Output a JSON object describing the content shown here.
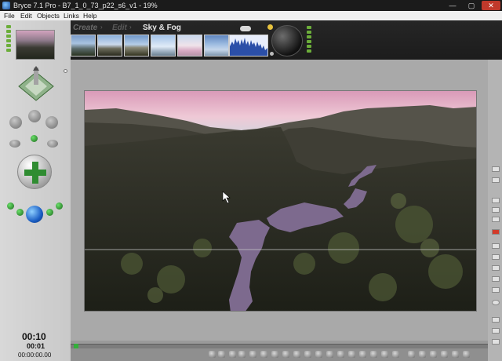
{
  "window": {
    "title": "Bryce 7.1  Pro - B7_1_0_73_p22_s6_v1 - 19%",
    "minimize": "—",
    "maximize": "▢",
    "close": "✕"
  },
  "menu": {
    "file": "File",
    "edit": "Edit",
    "objects": "Objects",
    "links": "Links",
    "help": "Help"
  },
  "palette": {
    "create": "Create",
    "edit": "Edit",
    "sky_fog": "Sky & Fog"
  },
  "time": {
    "main": "00:10",
    "frame": "00:01",
    "code": "00:00:00.00"
  },
  "colors": {
    "accent_green": "#6cae3a",
    "close_red": "#c0392b",
    "sky_pink": "#e8a8c2",
    "water": "#7d6a8e"
  }
}
